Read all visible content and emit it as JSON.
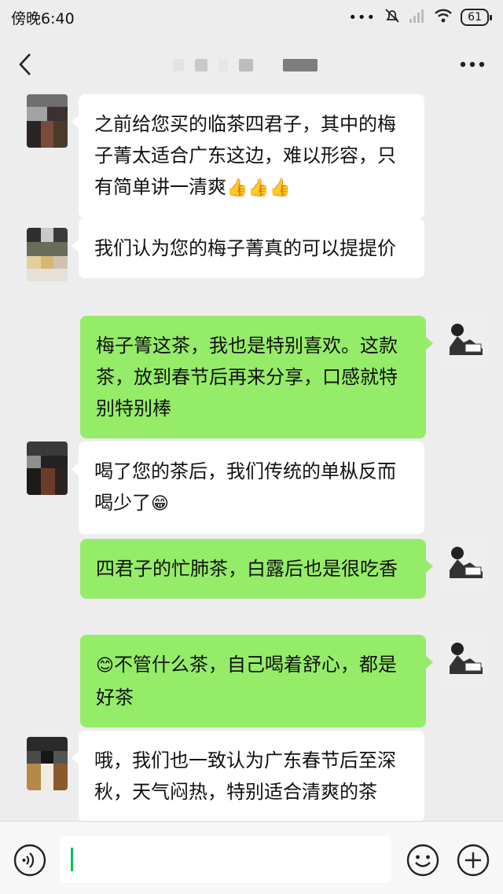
{
  "status_bar": {
    "time": "傍晚6:40",
    "battery": "61",
    "icons": [
      "dots-icon",
      "mute-icon",
      "signal-icon",
      "wifi-icon",
      "battery-icon"
    ]
  },
  "nav": {
    "back_icon": "back-arrow-icon",
    "more_icon": "more-dots-icon"
  },
  "messages": [
    {
      "side": "in",
      "text": "之前给您买的临茶四君子，其中的梅子菁太适合广东这边，难以形容，只有简单讲一清爽",
      "emoji": "👍👍👍"
    },
    {
      "side": "in",
      "text": "我们认为您的梅子菁真的可以提提价",
      "emoji": ""
    },
    {
      "side": "out",
      "text": "梅子箐这茶，我也是特别喜欢。这款茶，放到春节后再来分享，口感就特别特别棒",
      "emoji": ""
    },
    {
      "side": "in",
      "text": "喝了您的茶后，我们传统的单枞反而喝少了",
      "emoji": "😁"
    },
    {
      "side": "out",
      "text": "四君子的忙肺茶，白露后也是很吃香",
      "emoji": ""
    },
    {
      "side": "out",
      "text": "不管什么茶，自己喝着舒心，都是好茶",
      "emoji_lead": "😊"
    },
    {
      "side": "in",
      "text": "哦，我们也一致认为广东春节后至深秋，天气闷热，特别适合清爽的茶",
      "emoji": ""
    }
  ],
  "input_bar": {
    "voice_icon": "voice-icon",
    "emoji_icon": "emoji-face-icon",
    "plus_icon": "plus-icon"
  }
}
